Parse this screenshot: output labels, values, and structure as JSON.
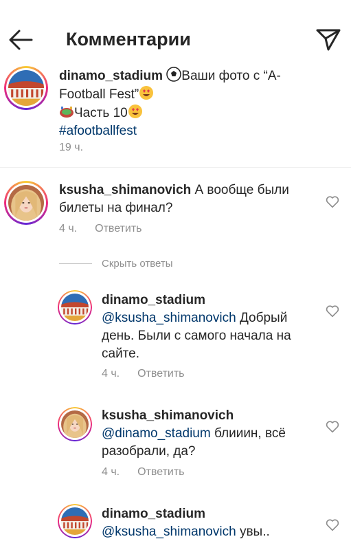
{
  "header": {
    "title": "Комментарии"
  },
  "post": {
    "username": "dinamo_stadium",
    "line1_text": "Ваши фото с “A-",
    "line2_text": "Football Fest”",
    "line3_text": "Часть 10",
    "hashtag": "#afootballfest",
    "time": "19 ч."
  },
  "comment": {
    "username": "ksusha_shimanovich",
    "text_line1": "А вообще были",
    "text_line2": "билеты на финал?",
    "time": "4 ч.",
    "reply_label": "Ответить"
  },
  "hide_replies_label": "Скрыть ответы",
  "replies": [
    {
      "username": "dinamo_stadium",
      "mention": "@ksusha_shimanovich",
      "text_line1_tail": " Добрый",
      "text_line2": "день. Были с самого начала на",
      "text_line3": "сайте.",
      "time": "4 ч.",
      "reply_label": "Ответить"
    },
    {
      "username": "ksusha_shimanovich",
      "mention": "@dinamo_stadium",
      "text_line1_tail": " блииин, всё",
      "text_line2": "разобрали, да?",
      "time": "4 ч.",
      "reply_label": "Ответить"
    },
    {
      "username": "dinamo_stadium",
      "mention": "@ksusha_shimanovich",
      "text_line1_tail": " увы.."
    }
  ],
  "colors": {
    "link": "#00376b",
    "secondary": "#8e8e8e",
    "text": "#262626"
  }
}
